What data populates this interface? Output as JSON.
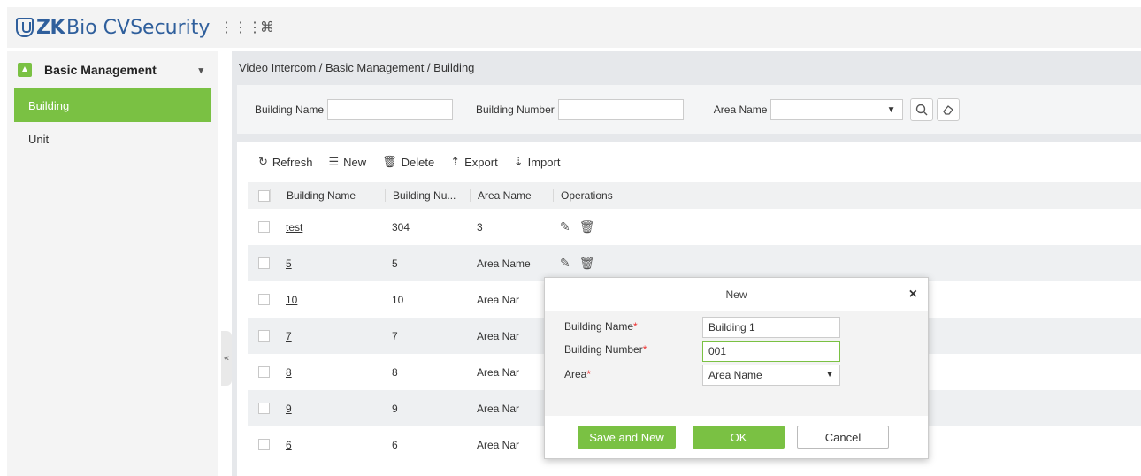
{
  "app": {
    "brand_bold": "ZK",
    "brand_rest": "Bio CVSecurity"
  },
  "topbar": {
    "grid_icon": "⋮⋮⋮",
    "command_icon": "⌘"
  },
  "sidebar": {
    "module_label": "Basic Management",
    "items": [
      {
        "label": "Building",
        "active": true
      },
      {
        "label": "Unit",
        "active": false
      }
    ]
  },
  "breadcrumb": "Video Intercom / Basic Management / Building",
  "search": {
    "building_name_label": "Building Name",
    "building_name_value": "",
    "building_number_label": "Building Number",
    "building_number_value": "",
    "area_name_label": "Area Name",
    "area_name_value": ""
  },
  "toolbar": {
    "refresh": "Refresh",
    "new": "New",
    "delete": "Delete",
    "export": "Export",
    "import": "Import"
  },
  "table": {
    "headers": [
      "Building Name",
      "Building Nu...",
      "Area Name",
      "Operations"
    ],
    "rows": [
      {
        "name": "test",
        "number": "304",
        "area": "3"
      },
      {
        "name": "5",
        "number": "5",
        "area": "Area Name"
      },
      {
        "name": "10",
        "number": "10",
        "area": "Area Nar"
      },
      {
        "name": "7",
        "number": "7",
        "area": "Area Nar"
      },
      {
        "name": "8",
        "number": "8",
        "area": "Area Nar"
      },
      {
        "name": "9",
        "number": "9",
        "area": "Area Nar"
      },
      {
        "name": "6",
        "number": "6",
        "area": "Area Nar"
      }
    ]
  },
  "dialog": {
    "title": "New",
    "close": "×",
    "fields": {
      "building_name_label": "Building Name",
      "building_name_value": "Building 1",
      "building_number_label": "Building Number",
      "building_number_value": "001",
      "area_label": "Area",
      "area_value": "Area Name",
      "required_mark": "*"
    },
    "buttons": {
      "save_and_new": "Save and New",
      "ok": "OK",
      "cancel": "Cancel"
    }
  },
  "collapse": "«",
  "colors": {
    "accent": "#7ac143",
    "brand": "#2f5f9c"
  }
}
